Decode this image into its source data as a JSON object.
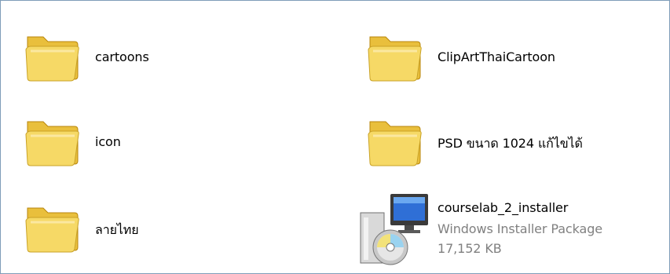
{
  "items": [
    {
      "name": "cartoons",
      "type": "folder"
    },
    {
      "name": "ClipArtThaiCartoon",
      "type": "folder"
    },
    {
      "name": "icon",
      "type": "folder"
    },
    {
      "name": "PSD ขนาด 1024 แก้ไขได้",
      "type": "folder"
    },
    {
      "name": "ลายไทย",
      "type": "folder"
    },
    {
      "name": "courselab_2_installer",
      "type": "installer",
      "file_type": "Windows Installer Package",
      "size": "17,152 KB"
    }
  ],
  "colors": {
    "folder_front": "#f6d966",
    "folder_back": "#e9bf3c",
    "folder_edge": "#b8860b",
    "window_border": "#7f9db9",
    "secondary_text": "#808080"
  }
}
